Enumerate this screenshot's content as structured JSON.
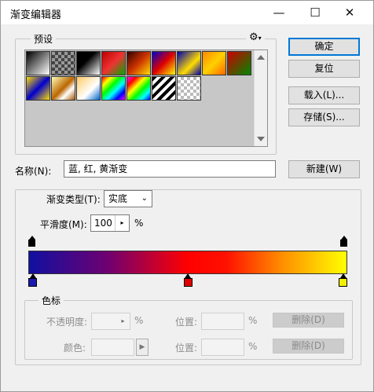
{
  "window": {
    "title": "渐变编辑器",
    "minimize": "—",
    "maximize": "☐",
    "close": "✕"
  },
  "presets": {
    "legend": "预设",
    "menu_icon": "gear-icon",
    "swatches_row1": [
      "linear-gradient(135deg,#000,#fff)",
      "checker-black",
      "linear-gradient(135deg,#000 40%,#fff)",
      "linear-gradient(135deg,#b00,#e33 50%,#0a0)",
      "linear-gradient(135deg,#300,#c30 50%,#fd0)",
      "linear-gradient(135deg,#00c,#d00 50%,#ff0)",
      "linear-gradient(135deg,#00a,#fd0 60%,#00a)",
      "linear-gradient(135deg,#f80,#ffd000 50%,#f60)",
      "linear-gradient(135deg,#c00,#080)"
    ],
    "swatches_row2": [
      "linear-gradient(135deg,#fd0,#00c 50%,#fd0)",
      "linear-gradient(135deg,#ffb,#b60 50%,#fff 70%,#a50)",
      "linear-gradient(135deg,#fc6,#fff 60%,#06c)",
      "linear-gradient(135deg,#f00,#ff0,#0f0,#0ff,#00f,#f0f)",
      "linear-gradient(135deg,#f0f,#f00,#ff0,#0f0,#0ff,#00f)",
      "repeating-linear-gradient(135deg,#000 0 4px,#fff 4px 8px)",
      "checker-light"
    ]
  },
  "buttons": {
    "ok": "确定",
    "reset": "复位",
    "load": "载入(L)...",
    "save": "存储(S)...",
    "new": "新建(W)",
    "delete1": "删除(D)",
    "delete2": "删除(D)"
  },
  "name": {
    "label": "名称(N):",
    "value": "蓝, 红, 黄渐变"
  },
  "gradient": {
    "type_label": "渐变类型(T):",
    "type_value": "实底",
    "smooth_label": "平滑度(M):",
    "smooth_value": "100",
    "smooth_unit": "%",
    "bar_css": "linear-gradient(to right,#1010a0 0%,#700070 25%,#ff0000 50%,#ff1000 62%,#ff9000 80%,#ffff00 100%)",
    "color_stops": [
      {
        "position": 0,
        "color": "#1a1ab0"
      },
      {
        "position": 50,
        "color": "#e00000"
      },
      {
        "position": 100,
        "color": "#f2f000"
      }
    ],
    "opacity_stops": [
      0,
      100
    ]
  },
  "stops": {
    "legend": "色标",
    "opacity_label": "不透明度:",
    "opacity_unit": "%",
    "position_label1": "位置:",
    "position_unit1": "%",
    "color_label": "颜色:",
    "position_label2": "位置:",
    "position_unit2": "%"
  }
}
